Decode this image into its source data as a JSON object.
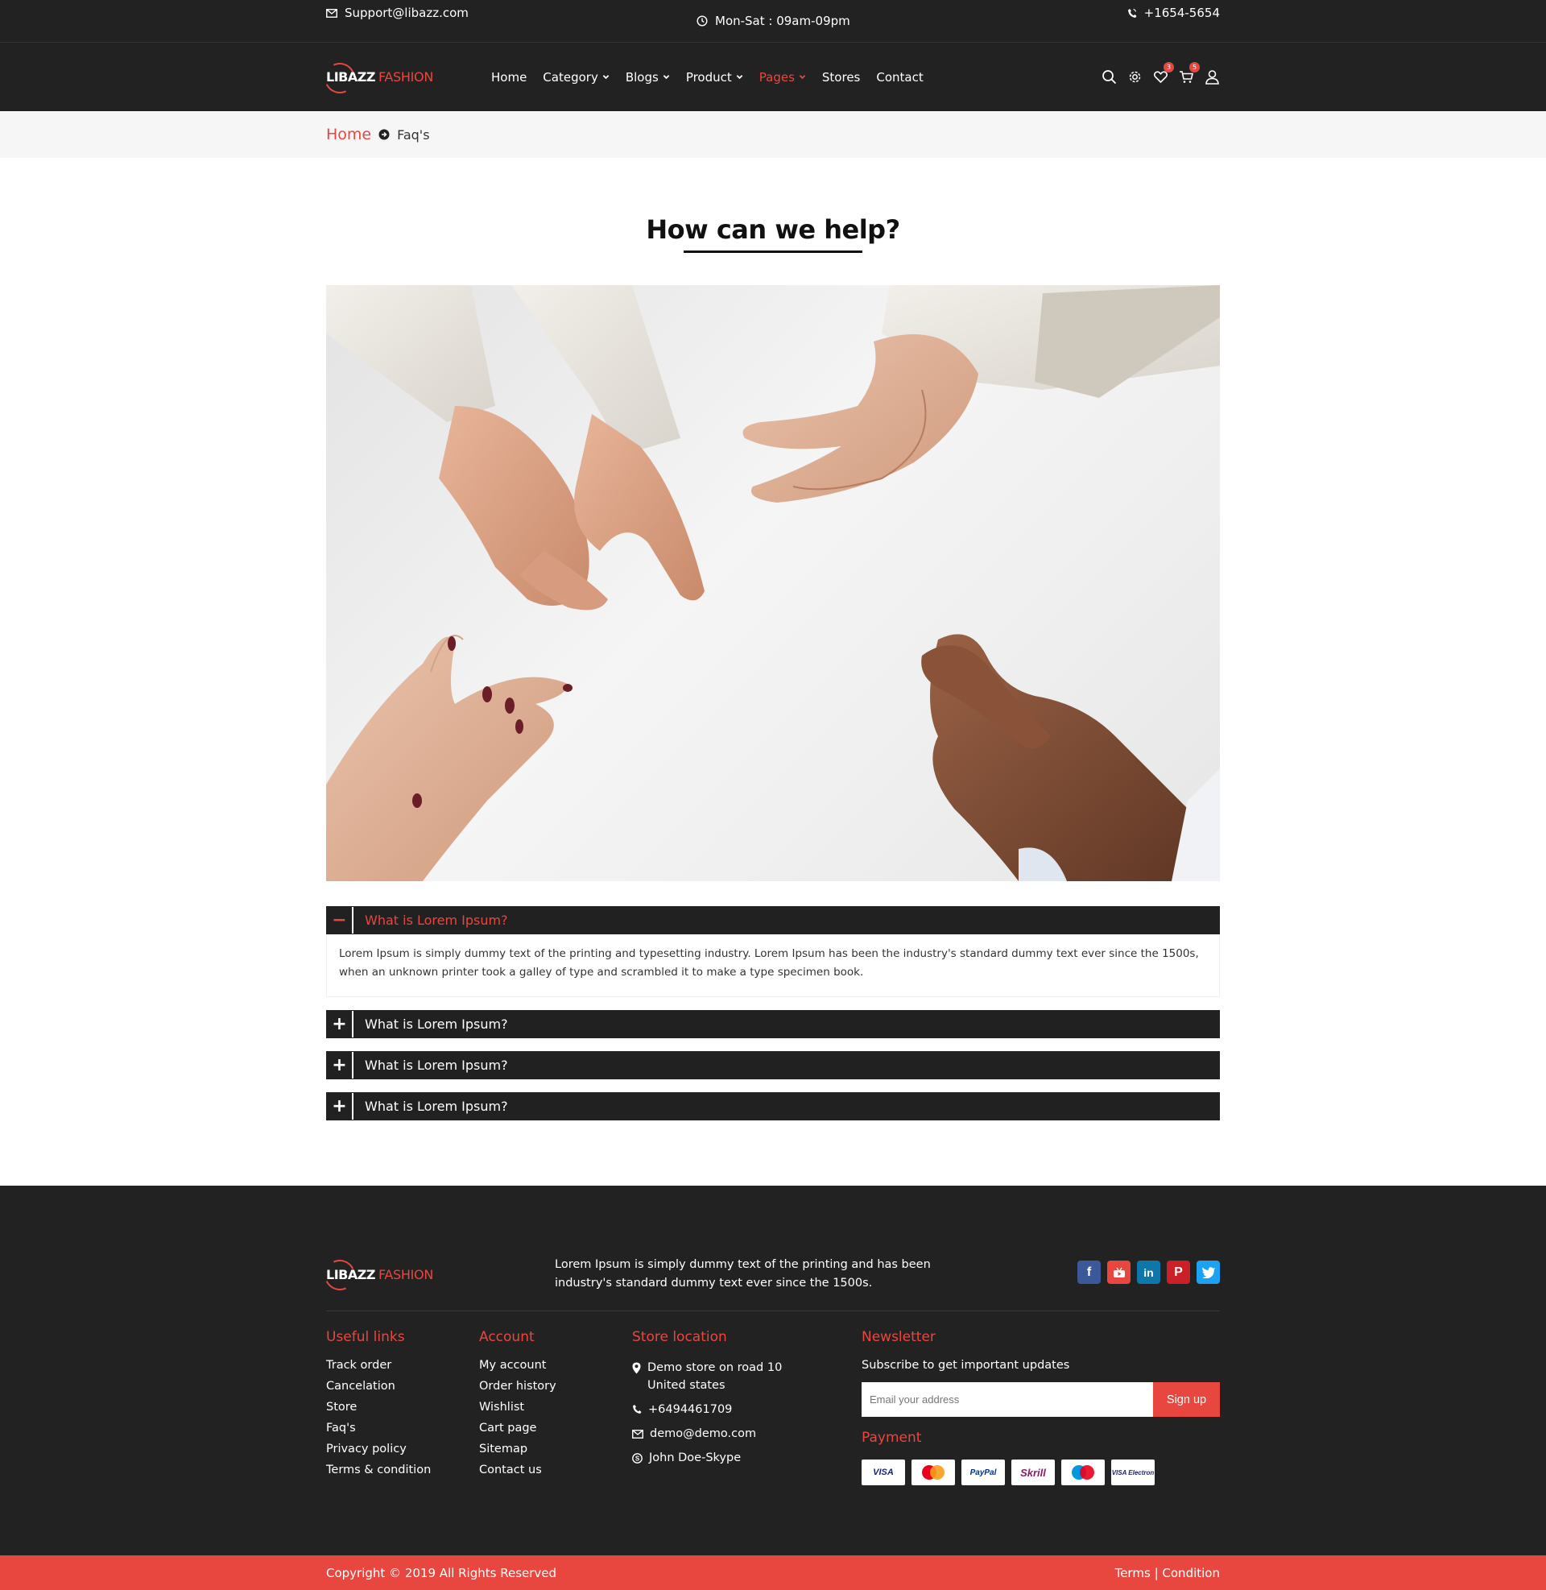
{
  "topbar": {
    "email": "Support@libazz.com",
    "hours": "Mon-Sat : 09am-09pm",
    "phone": "+1654-5654"
  },
  "brand": {
    "name_part1": "LIBAZZ",
    "name_part2": "FASHION",
    "accent_color": "#e8473f",
    "dark_color": "#222222"
  },
  "nav": {
    "items": [
      {
        "label": "Home",
        "has_dropdown": false
      },
      {
        "label": "Category",
        "has_dropdown": true
      },
      {
        "label": "Blogs",
        "has_dropdown": true
      },
      {
        "label": "Product",
        "has_dropdown": true
      },
      {
        "label": "Pages",
        "has_dropdown": true,
        "active": true
      },
      {
        "label": "Stores",
        "has_dropdown": false
      },
      {
        "label": "Contact",
        "has_dropdown": false
      }
    ],
    "icons": [
      "search-icon",
      "settings-icon",
      "wishlist-icon",
      "cart-icon",
      "user-icon"
    ],
    "wishlist_count": "3",
    "cart_count": "5"
  },
  "breadcrumb": {
    "home": "Home",
    "current": "Faq's"
  },
  "main": {
    "title": "How can we help?"
  },
  "faq": {
    "items": [
      {
        "question": "What is Lorem Ipsum?",
        "open": true,
        "answer": "Lorem Ipsum is simply dummy text of the printing and typesetting industry. Lorem Ipsum has been the industry's standard dummy text ever since the 1500s, when an unknown printer took a galley of type and scrambled it to make a type specimen book."
      },
      {
        "question": "What is Lorem Ipsum?",
        "open": false
      },
      {
        "question": "What is Lorem Ipsum?",
        "open": false
      },
      {
        "question": "What is Lorem Ipsum?",
        "open": false
      }
    ],
    "open_symbol": "−",
    "closed_symbol": "+"
  },
  "footer": {
    "about": "Lorem Ipsum is simply dummy text of the printing and has been industry's standard dummy text ever since the 1500s.",
    "socials": [
      "facebook-icon",
      "youtube-icon",
      "linkedin-icon",
      "pinterest-icon",
      "twitter-icon"
    ],
    "useful_links": {
      "title": "Useful links",
      "items": [
        "Track order",
        "Cancelation",
        "Store",
        "Faq's",
        "Privacy policy",
        "Terms & condition"
      ]
    },
    "account": {
      "title": "Account",
      "items": [
        "My account",
        "Order history",
        "Wishlist",
        "Cart page",
        "Sitemap",
        "Contact us"
      ]
    },
    "store_location": {
      "title": "Store location",
      "address_line1": "Demo store on road 10",
      "address_line2": "United states",
      "phone": "+6494461709",
      "email": "demo@demo.com",
      "skype": "John Doe-Skype"
    },
    "newsletter": {
      "title": "Newsletter",
      "subtitle": "Subscribe to get important updates",
      "placeholder": "Email your address",
      "button": "Sign up"
    },
    "payment": {
      "title": "Payment",
      "methods": [
        "VISA",
        "MasterCard",
        "PayPal",
        "Skrill",
        "Maestro",
        "VISA Electron"
      ]
    }
  },
  "copyright": {
    "text": "Copyright © 2019 All Rights Reserved",
    "terms": "Terms",
    "separator": "|",
    "condition": "Condition"
  }
}
